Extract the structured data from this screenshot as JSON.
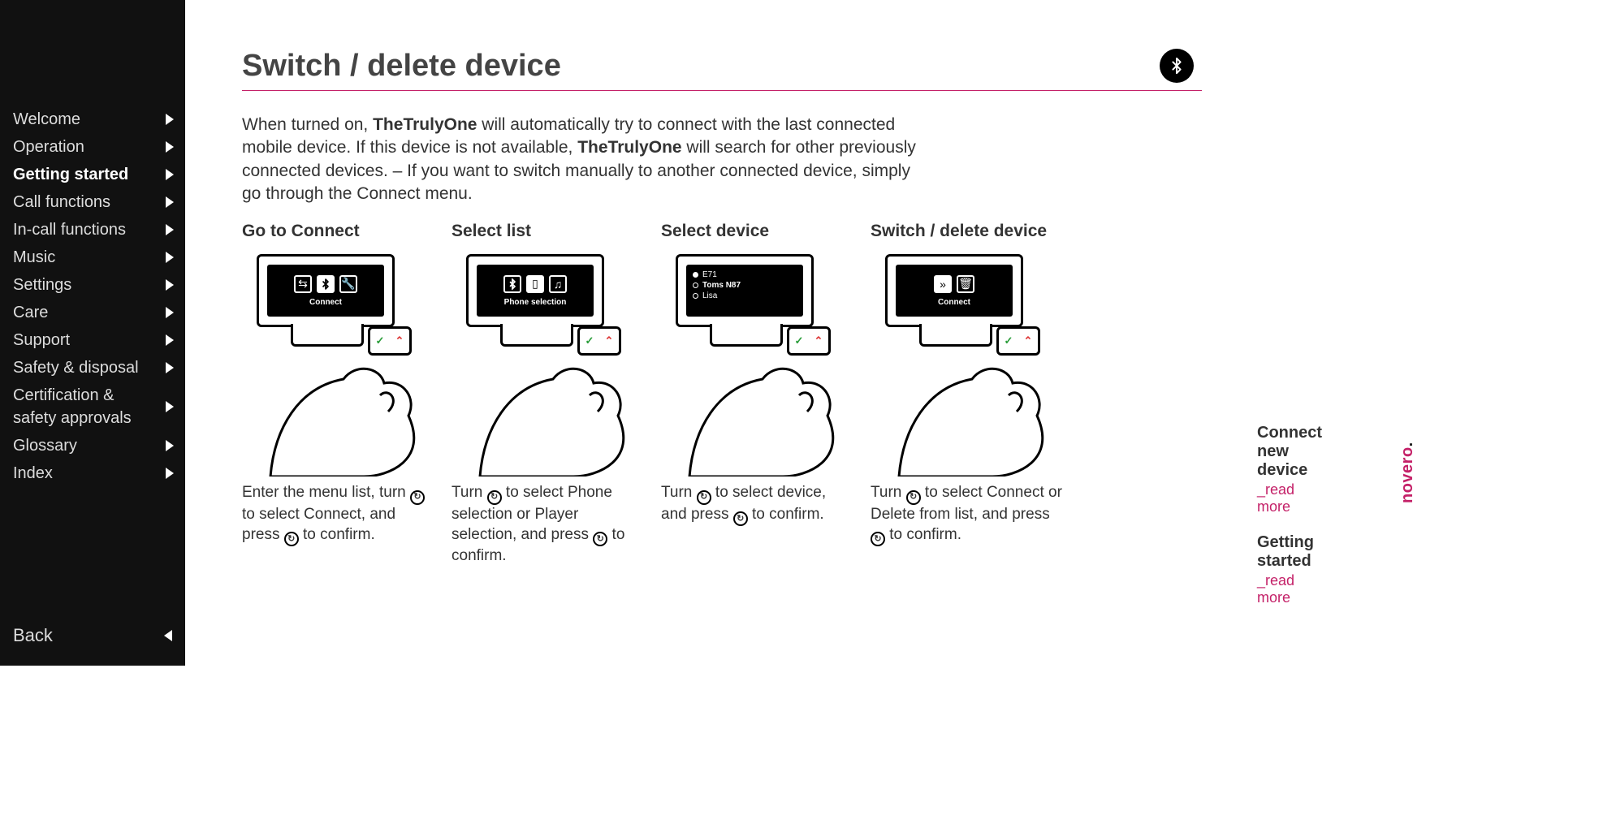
{
  "sidebar": {
    "items": [
      {
        "label": "Welcome"
      },
      {
        "label": "Operation"
      },
      {
        "label": "Getting started",
        "active": true
      },
      {
        "label": "Call functions"
      },
      {
        "label": "In-call functions"
      },
      {
        "label": "Music"
      },
      {
        "label": "Settings"
      },
      {
        "label": "Care"
      },
      {
        "label": "Support"
      },
      {
        "label": "Safety & disposal"
      },
      {
        "label": "Certification & safety approvals"
      },
      {
        "label": "Glossary"
      },
      {
        "label": "Index"
      }
    ],
    "back_label": "Back"
  },
  "page": {
    "title": "Switch / delete device",
    "intro_pre": "When turned on, ",
    "product": "TheTrulyOne",
    "intro_mid": " will automatically try to connect with the last connected mobile device. If this device is not available, ",
    "intro_post": " will search for other previously connected devices. – If you want to switch manually to another connected device, simply go through the Connect menu."
  },
  "steps": [
    {
      "title": "Go to Connect",
      "screen_label": "Connect",
      "caption_a": "Enter the menu list, turn ",
      "caption_b": " to select Connect, and press ",
      "caption_c": " to confirm."
    },
    {
      "title": "Select list",
      "screen_label": "Phone selection",
      "caption_a": "Turn ",
      "caption_b": " to select Phone selection or Player selection, and press ",
      "caption_c": " to confirm."
    },
    {
      "title": "Select device",
      "screen_label": "",
      "device_list": [
        "E71",
        "Toms N87",
        "Lisa"
      ],
      "caption_a": "Turn ",
      "caption_b": " to select device, and press ",
      "caption_c": " to confirm."
    },
    {
      "title": "Switch / delete device",
      "screen_label": "Connect",
      "caption_a": "Turn ",
      "caption_b": " to select Connect or Delete from list, and press ",
      "caption_c": " to confirm."
    }
  ],
  "right": {
    "link1_title": "Connect new device",
    "link2_title": "Getting started",
    "read_more": "_read more"
  },
  "brand": "novero"
}
